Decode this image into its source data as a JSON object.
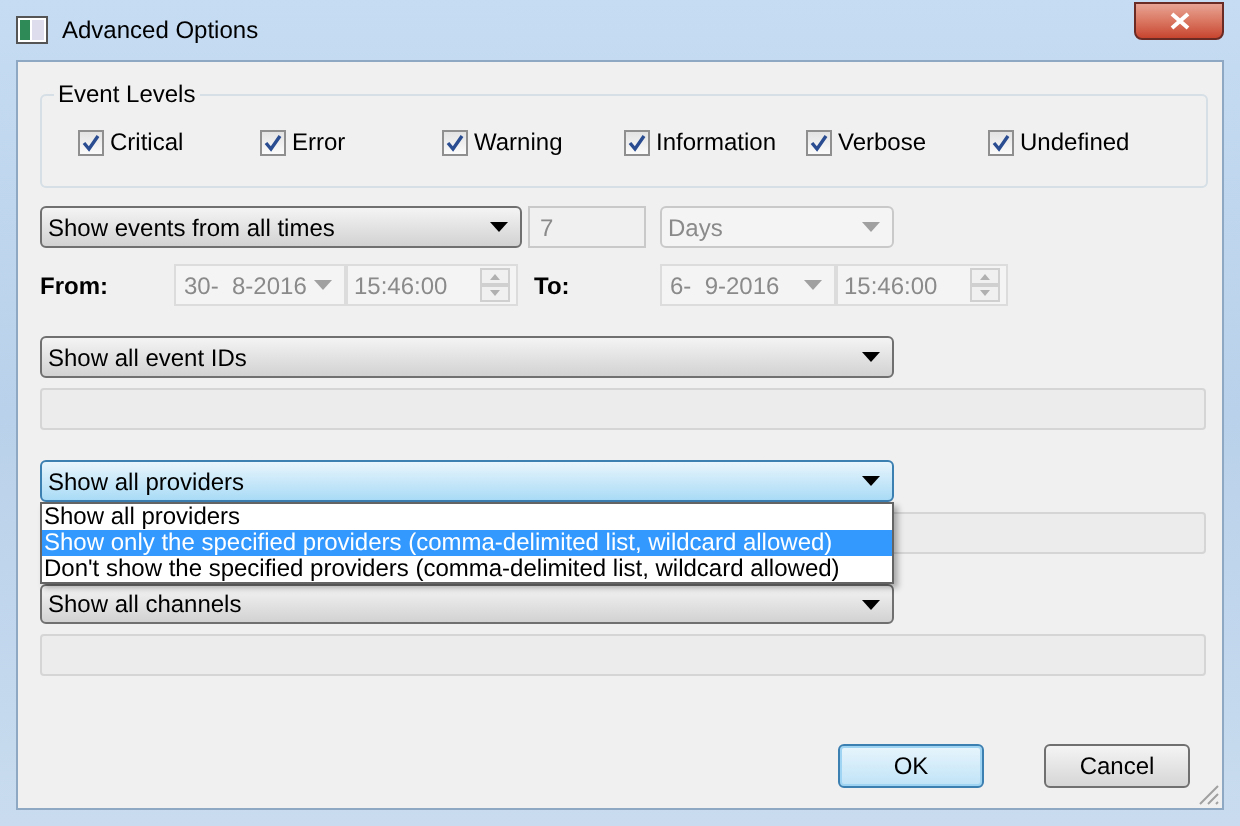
{
  "window": {
    "title": "Advanced Options"
  },
  "event_levels": {
    "title": "Event Levels",
    "items": [
      {
        "label": "Critical",
        "checked": true
      },
      {
        "label": "Error",
        "checked": true
      },
      {
        "label": "Warning",
        "checked": true
      },
      {
        "label": "Information",
        "checked": true
      },
      {
        "label": "Verbose",
        "checked": true
      },
      {
        "label": "Undefined",
        "checked": true
      }
    ]
  },
  "time_range": {
    "mode": "Show events from all times",
    "count": {
      "value": "7",
      "disabled": true
    },
    "unit": {
      "value": "Days",
      "disabled": true
    },
    "from_label": "From:",
    "from_date": {
      "value": "30-  8-2016",
      "disabled": true
    },
    "from_time": {
      "value": "15:46:00",
      "disabled": true
    },
    "to_label": "To:",
    "to_date": {
      "value": "6-  9-2016",
      "disabled": true
    },
    "to_time": {
      "value": "15:46:00",
      "disabled": true
    }
  },
  "event_ids": {
    "value": "Show all event IDs"
  },
  "providers": {
    "value": "Show all providers",
    "focused": true,
    "expanded": true,
    "options": [
      {
        "label": "Show all providers",
        "highlighted": false
      },
      {
        "label": "Show only the specified providers (comma-delimited list, wildcard allowed)",
        "highlighted": true
      },
      {
        "label": "Don't show the specified providers (comma-delimited list, wildcard allowed)",
        "highlighted": false
      }
    ]
  },
  "channels": {
    "value": "Show all channels"
  },
  "buttons": [
    {
      "label": "OK",
      "kind": "default"
    },
    {
      "label": "Cancel",
      "kind": "normal"
    }
  ]
}
